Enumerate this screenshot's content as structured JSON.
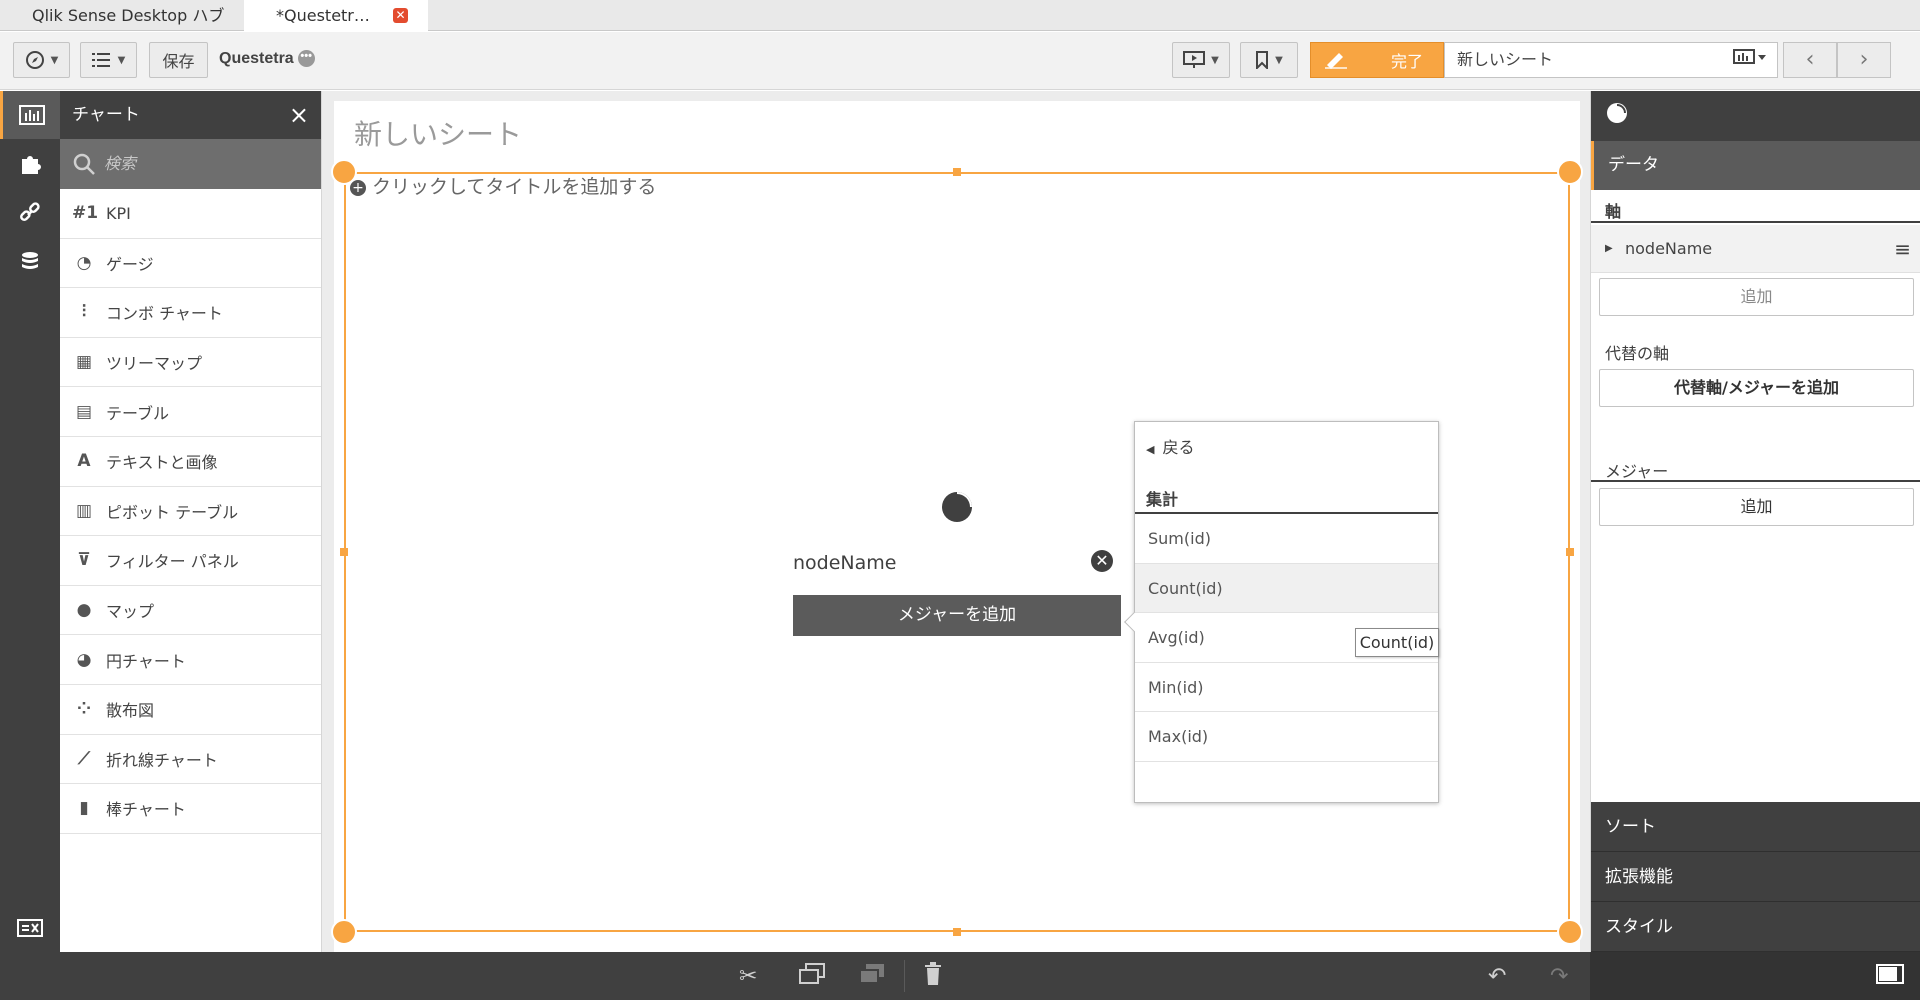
{
  "tabs": [
    {
      "label": "Qlik Sense Desktop ハブ"
    },
    {
      "label": "*Questetr…",
      "close": "✕"
    }
  ],
  "toolbar": {
    "save_label": "保存",
    "app_title": "Questetra",
    "done_label": "完了",
    "sheet_name": "新しいシート"
  },
  "chart_panel": {
    "title": "チャート",
    "search_placeholder": "検索",
    "items": [
      {
        "icon": "#1",
        "label": "KPI"
      },
      {
        "icon": "◔",
        "label": "ゲージ"
      },
      {
        "icon": "⫶",
        "label": "コンボ チャート"
      },
      {
        "icon": "▦",
        "label": "ツリーマップ"
      },
      {
        "icon": "▤",
        "label": "テーブル"
      },
      {
        "icon": "A",
        "label": "テキストと画像"
      },
      {
        "icon": "▥",
        "label": "ピボット テーブル"
      },
      {
        "icon": "⊽",
        "label": "フィルター パネル"
      },
      {
        "icon": "●",
        "label": "マップ"
      },
      {
        "icon": "◕",
        "label": "円チャート"
      },
      {
        "icon": "⁘",
        "label": "散布図"
      },
      {
        "icon": "⟋",
        "label": "折れ線チャート"
      },
      {
        "icon": "▮",
        "label": "棒チャート"
      }
    ]
  },
  "sheet": {
    "title": "新しいシート",
    "add_title_hint": "クリックしてタイトルを追加する",
    "dimension": "nodeName",
    "add_measure_label": "メジャーを追加"
  },
  "popover": {
    "back_label": "戻る",
    "section_label": "集計",
    "items": [
      "Sum(id)",
      "Count(id)",
      "Avg(id)",
      "Min(id)",
      "Max(id)"
    ],
    "tooltip": "Count(id)"
  },
  "properties": {
    "data_label": "データ",
    "dimensions_label": "軸",
    "dimension_item": "nodeName",
    "add_label": "追加",
    "alt_label": "代替の軸",
    "alt_button": "代替軸/メジャーを追加",
    "measures_label": "メジャー",
    "measure_add_label": "追加",
    "sort_label": "ソート",
    "addons_label": "拡張機能",
    "style_label": "スタイル"
  },
  "colors": {
    "accent": "#f8a542",
    "dark": "#404040"
  }
}
